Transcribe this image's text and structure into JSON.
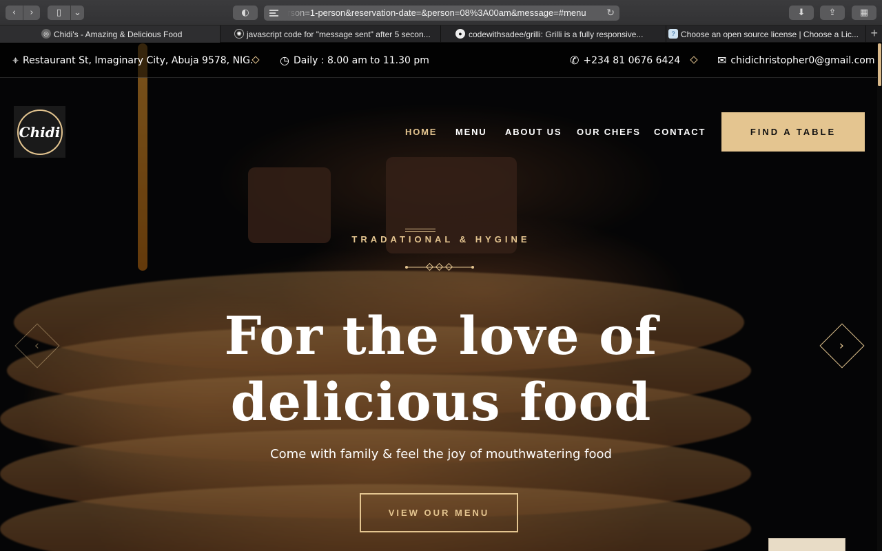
{
  "browser": {
    "url": "rson=1-person&reservation-date=&person=08%3A00am&message=#menu",
    "reload_glyph": "↻",
    "back_glyph": "‹",
    "forward_glyph": "›",
    "sidebar_glyph": "▯",
    "dropdown_glyph": "⌄",
    "shield_glyph": "◐",
    "download_glyph": "⬇",
    "share_glyph": "⇪",
    "grid_glyph": "▦",
    "new_tab_glyph": "+",
    "tabs": [
      {
        "title": "Chidi's - Amazing & Delicious Food",
        "favicon": "compass-icon",
        "fav_glyph": "◎"
      },
      {
        "title": "javascript code for \"message sent\" after 5 secon...",
        "favicon": "openai-icon",
        "fav_glyph": "✺"
      },
      {
        "title": "codewithsadee/grilli: Grilli is a fully responsive...",
        "favicon": "github-icon",
        "fav_glyph": "●"
      },
      {
        "title": "Choose an open source license | Choose a Lic...",
        "favicon": "license-icon",
        "fav_glyph": "?"
      }
    ]
  },
  "topbar": {
    "address": "Restaurant St, Imaginary City, Abuja 9578, NIG.",
    "hours": "Daily : 8.00 am to 11.30 pm",
    "phone": "+234 81 0676 6424",
    "email": "chidichristopher0@gmail.com",
    "address_icon": "⌖",
    "hours_icon": "◷",
    "phone_icon": "✆",
    "email_icon": "✉"
  },
  "logo": {
    "text": "Chidi"
  },
  "nav": {
    "items": [
      {
        "label": "HOME",
        "active": true
      },
      {
        "label": "MENU"
      },
      {
        "label": "ABOUT US"
      },
      {
        "label": "OUR CHEFS"
      },
      {
        "label": "CONTACT"
      }
    ],
    "cta": "FIND A TABLE"
  },
  "hero": {
    "eyebrow": "TRADATIONAL & HYGINE",
    "title_line1": "For the love of",
    "title_line2": "delicious food",
    "subtitle": "Come with family & feel the joy of mouthwatering food",
    "button": "VIEW OUR MENU",
    "prev_glyph": "‹",
    "next_glyph": "›"
  },
  "colors": {
    "accent": "#e4c590",
    "background": "#0a0a0b"
  }
}
